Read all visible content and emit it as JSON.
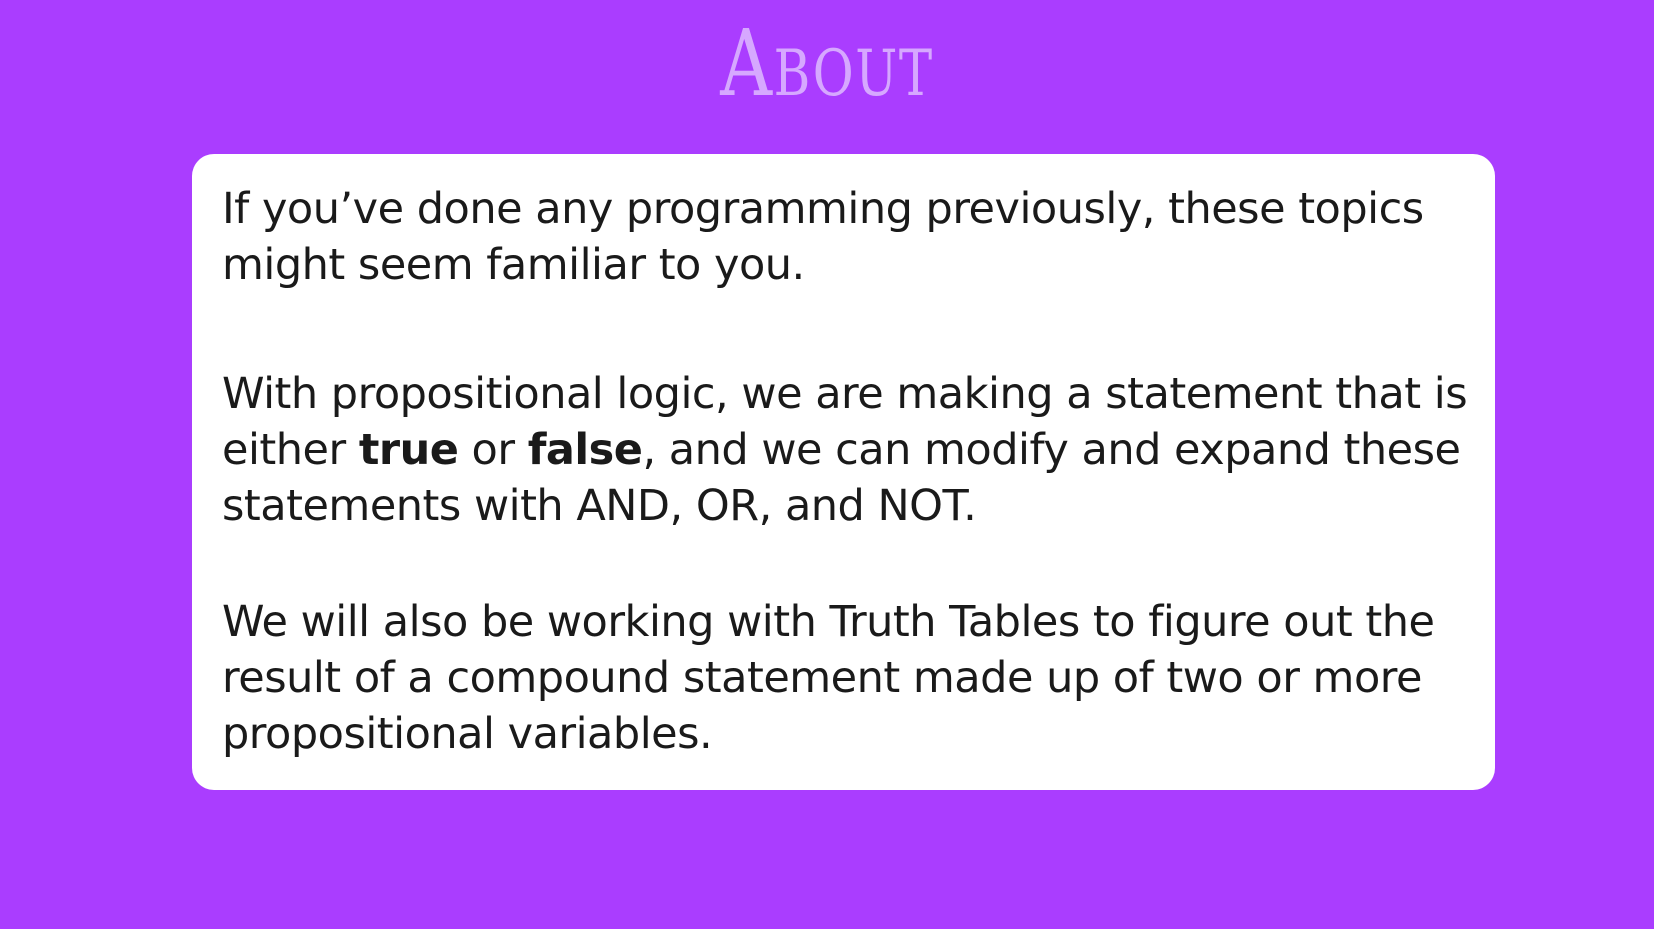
{
  "slide": {
    "title": "About",
    "background_color": "#aa3dff",
    "title_color": "#d6a8ff"
  },
  "content": {
    "paragraph_1": "If you’ve done any programming previously, these topics might seem familiar to you.",
    "paragraph_2": {
      "part_1": "With propositional logic, we are making a statement that is either ",
      "true_word": "true",
      "part_2": " or ",
      "false_word": "false",
      "part_3": ", and we can modify and expand these statements with AND, OR, and NOT."
    },
    "paragraph_3": "We will also be working with Truth Tables to figure out the result of a compound statement made up of two or more propositional variables."
  }
}
